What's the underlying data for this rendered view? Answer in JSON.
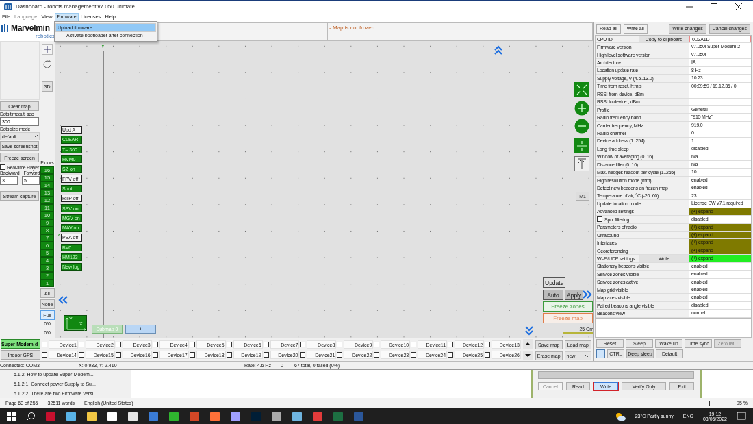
{
  "window": {
    "title": "Dashboard - robots management   v7.050   ultimate"
  },
  "menu": [
    {
      "label": "File",
      "disabled": false,
      "selected": false
    },
    {
      "label": "Language",
      "disabled": true,
      "selected": false
    },
    {
      "label": "View",
      "disabled": false,
      "selected": false
    },
    {
      "label": "Firmware",
      "disabled": false,
      "selected": true
    },
    {
      "label": "Licenses",
      "disabled": false,
      "selected": false
    },
    {
      "label": "Help",
      "disabled": false,
      "selected": false
    }
  ],
  "dropdown": [
    {
      "label": "Upload firmware",
      "selected": true
    },
    {
      "label": "Activate bootloader after connection",
      "selected": false
    }
  ],
  "logo": {
    "name": "Marvelmin",
    "sub": "robotics"
  },
  "map_header": {
    "status": "- Map is not frozen"
  },
  "left_panel": {
    "clear_map": "Clear map",
    "dots_timeout_label": "Dots timeout, sec",
    "dots_timeout": "300",
    "dots_size_label": "Dots size mode",
    "dots_size": "default",
    "save_screenshot": "Save screenshot",
    "freeze_screen": "Freeze screen",
    "realtime": {
      "label": "Real-time Player",
      "checked": false
    },
    "backward_label": "Backward",
    "forward_label": "Forward",
    "backward": "3",
    "forward": "5",
    "stream_capture": "Stream capture"
  },
  "tools": {
    "three_d": "3D"
  },
  "floors": {
    "label": "Floors",
    "items": [
      "16",
      "15",
      "14",
      "13",
      "12",
      "11",
      "10",
      "9",
      "8",
      "7",
      "6",
      "5",
      "4",
      "3",
      "2",
      "1"
    ],
    "all": "All",
    "none": "None",
    "full": {
      "label": "Full",
      "selected": true
    },
    "counters": [
      "0/0",
      "0/0"
    ]
  },
  "map": {
    "y_label": "Y",
    "x_mark": "×",
    "m1": "M1",
    "update": "Update",
    "auto": "Auto",
    "apply": "Apply",
    "freeze_zones": "Freeze zones",
    "freeze_map": "Freeze map",
    "scale": "25 Cm",
    "axes": {
      "y": "Y",
      "x": "X"
    },
    "submap": "Submap 0",
    "add_submap": "+"
  },
  "map_buttons": [
    {
      "label": "Upd A",
      "on": false
    },
    {
      "label": "CLEAR",
      "on": true
    },
    {
      "label": "T= 300",
      "on": true
    },
    {
      "label": "HVM0",
      "on": true
    },
    {
      "label": "SZ on",
      "on": true
    },
    {
      "label": "FPV off",
      "on": false
    },
    {
      "label": "Shot",
      "on": true
    },
    {
      "label": "RTP off",
      "on": false
    },
    {
      "label": "SBV on",
      "on": true
    },
    {
      "label": "MGV on",
      "on": true
    },
    {
      "label": "MAV on",
      "on": true
    },
    {
      "label": "PBA off",
      "on": false
    },
    {
      "label": "BV0",
      "on": true
    },
    {
      "label": "HM123",
      "on": true
    },
    {
      "label": "New log",
      "on": true
    }
  ],
  "modems": [
    {
      "label": "Super-Modem-d",
      "selected": true
    },
    {
      "label": "Indoor GPS",
      "selected": false
    }
  ],
  "devices": [
    {
      "label": "Device1",
      "checked": false
    },
    {
      "label": "Device2",
      "checked": false
    },
    {
      "label": "Device3",
      "checked": false
    },
    {
      "label": "Device4",
      "checked": false
    },
    {
      "label": "Device5",
      "checked": false
    },
    {
      "label": "Device6",
      "checked": false
    },
    {
      "label": "Device7",
      "checked": false
    },
    {
      "label": "Device8",
      "checked": false
    },
    {
      "label": "Device9",
      "checked": false
    },
    {
      "label": "Device10",
      "checked": false
    },
    {
      "label": "Device11",
      "checked": false
    },
    {
      "label": "Device12",
      "checked": false
    },
    {
      "label": "Device13",
      "checked": false
    },
    {
      "label": "Device14",
      "checked": false
    },
    {
      "label": "Device15",
      "checked": false
    },
    {
      "label": "Device16",
      "checked": false
    },
    {
      "label": "Device17",
      "checked": false
    },
    {
      "label": "Device18",
      "checked": false
    },
    {
      "label": "Device19",
      "checked": false
    },
    {
      "label": "Device20",
      "checked": false
    },
    {
      "label": "Device21",
      "checked": false
    },
    {
      "label": "Device22",
      "checked": false
    },
    {
      "label": "Device23",
      "checked": false
    },
    {
      "label": "Device24",
      "checked": false
    },
    {
      "label": "Device25",
      "checked": false
    },
    {
      "label": "Device26",
      "checked": false
    }
  ],
  "map_actions": {
    "save": "Save map",
    "load": "Load map",
    "erase": "Erase map",
    "select": "new"
  },
  "right_panel": {
    "top_buttons": [
      "Read all",
      "Write all",
      "Write changes",
      "Cancel changes"
    ],
    "rows": [
      {
        "kind": "copy",
        "name": "CPU ID",
        "button": "Copy to clipboard",
        "value": "0D3A1D"
      },
      {
        "kind": "text",
        "name": "Firmware version",
        "value": "v7.050i Super-Modem-2"
      },
      {
        "kind": "text",
        "name": "High level software version",
        "value": "v7.050i"
      },
      {
        "kind": "text",
        "name": "Architecture",
        "value": "IA"
      },
      {
        "kind": "text",
        "name": "Location update rate",
        "value": "8 Hz"
      },
      {
        "kind": "text",
        "name": "Supply voltage, V (4.5..13.0)",
        "value": "10.23"
      },
      {
        "kind": "text",
        "name": "Time from reset, h:m:s",
        "value": "00:09:59 / 19.12.36 / 0"
      },
      {
        "kind": "text",
        "name": "RSSI from device, dBm"
      },
      {
        "kind": "text",
        "name": "RSSI to device , dBm"
      },
      {
        "kind": "text",
        "name": "Profile",
        "value": "General"
      },
      {
        "kind": "text",
        "name": "Radio frequency band",
        "value": "\"915 MHz\""
      },
      {
        "kind": "text",
        "name": "Carrier frequency, MHz",
        "value": "919.0"
      },
      {
        "kind": "text",
        "name": "Radio channel",
        "value": "0"
      },
      {
        "kind": "text",
        "name": "Device address (1..254)",
        "value": "1"
      },
      {
        "kind": "text",
        "name": "Long time sleep",
        "value": "disabled"
      },
      {
        "kind": "text",
        "name": "Window of averaging (0..16)",
        "value": "n/a"
      },
      {
        "kind": "text",
        "name": "Distance filter (0..16)",
        "value": "n/a"
      },
      {
        "kind": "text",
        "name": "Max. hedges readout per cycle (1..255)",
        "value": "10"
      },
      {
        "kind": "text",
        "name": "High resolution mode (mm)",
        "value": "enabled"
      },
      {
        "kind": "text",
        "name": "Detect new beacons on frozen map",
        "value": "enabled"
      },
      {
        "kind": "text",
        "name": "Temperature of air, °C (-20..60)",
        "value": "23"
      },
      {
        "kind": "text",
        "name": "Update location mode",
        "value": "License SW v7.1 required"
      },
      {
        "kind": "expand",
        "name": "Advanced settings",
        "value": "(+) expand",
        "color": "#7f7a00"
      },
      {
        "kind": "check",
        "name": "Spot filtering",
        "value": "disabled",
        "checked": false
      },
      {
        "kind": "expand",
        "name": "Parameters of radio",
        "value": "(+) expand",
        "color": "#7f7a00"
      },
      {
        "kind": "expand",
        "name": "Ultrasound",
        "value": "(+) expand",
        "color": "#7f7a00"
      },
      {
        "kind": "expand",
        "name": "Interfaces",
        "value": "(+) expand",
        "color": "#7f7a00"
      },
      {
        "kind": "expand",
        "name": "Georeferencing",
        "value": "(+) expand",
        "color": "#7f7a00"
      },
      {
        "kind": "write",
        "name": "Wi-Fi/UDP settings",
        "button": "Write",
        "value": "(+) expand",
        "color": "#22ee22"
      },
      {
        "kind": "text",
        "name": "Stationary beacons visible",
        "value": "enabled"
      },
      {
        "kind": "text",
        "name": "Service zones visible",
        "value": "enabled"
      },
      {
        "kind": "text",
        "name": "Service zones active",
        "value": "enabled"
      },
      {
        "kind": "text",
        "name": "Map grid visible",
        "value": "enabled"
      },
      {
        "kind": "text",
        "name": "Map axes visible",
        "value": "enabled"
      },
      {
        "kind": "text",
        "name": "Paired beacons angle visible",
        "value": "disabled"
      },
      {
        "kind": "text",
        "name": "Beacons view",
        "value": "normal"
      }
    ],
    "bottom_buttons": [
      {
        "label": "Reset",
        "disabled": false
      },
      {
        "label": "Sleep",
        "disabled": false
      },
      {
        "label": "Wake up",
        "disabled": false
      },
      {
        "label": "Time sync",
        "disabled": false
      },
      {
        "label": "Zero IMU",
        "disabled": true
      }
    ],
    "bottom_buttons_2": [
      "CTRL",
      "Deep sleep",
      "Default"
    ]
  },
  "status_bar": [
    "Connected: COM3",
    "X: 0.933, Y: 2.410",
    "Rate: 4.6 Hz",
    "0",
    "67 total, 0 failed (0%)"
  ],
  "word": {
    "nav": [
      "5.1.2. How to update Super-Modem...",
      "5.1.2.1. Connect power Supply to Su...",
      "5.1.2.2. There are two Firmware versi..."
    ],
    "dialog_buttons": [
      {
        "label": "Cancel",
        "disabled": true,
        "selected": false
      },
      {
        "label": "Read",
        "disabled": false,
        "selected": false
      },
      {
        "label": "Write",
        "disabled": false,
        "selected": true
      },
      {
        "label": "Verify Only",
        "disabled": false,
        "selected": false
      },
      {
        "label": "Exit",
        "disabled": false,
        "selected": false
      }
    ],
    "status": [
      "Page 63 of 255",
      "32511 words",
      "English (United States)"
    ],
    "zoom": "95 %",
    "zoom_slider": {
      "level": 0.55
    },
    "progress": {
      "level": 0
    }
  },
  "taskbar": {
    "weather": "23°C  Partly sunny",
    "language": "ENG",
    "time": "19.12",
    "date": "08/06/2022"
  }
}
